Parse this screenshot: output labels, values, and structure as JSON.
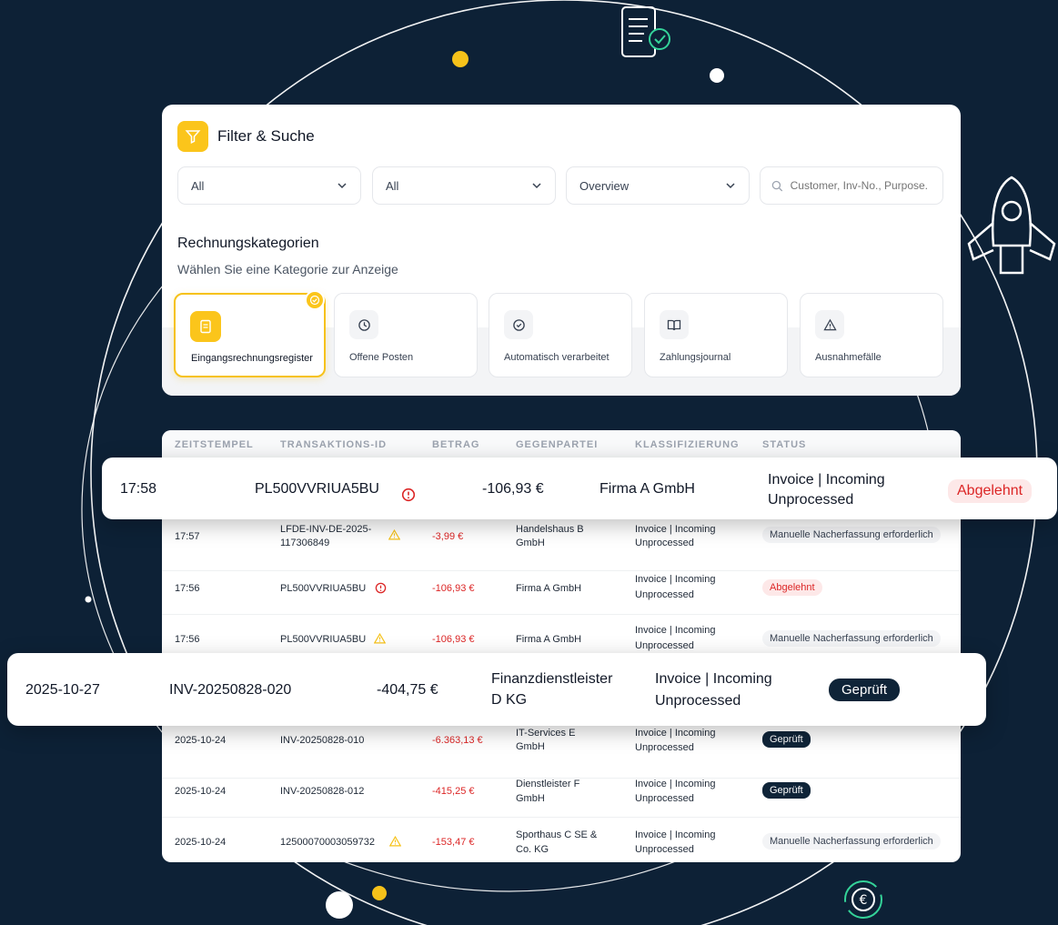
{
  "filter": {
    "title": "Filter & Suche",
    "select1": "All",
    "select2": "All",
    "select3": "Overview",
    "search_placeholder": "Customer, Inv-No., Purpose."
  },
  "categories": {
    "title": "Rechnungskategorien",
    "subtitle": "Wählen Sie eine Kategorie zur Anzeige",
    "items": [
      {
        "label": "Eingangsrechnungsregister",
        "icon": "document-icon",
        "active": true
      },
      {
        "label": "Offene Posten",
        "icon": "clock-icon"
      },
      {
        "label": "Automatisch verarbeitet",
        "icon": "check-circle-icon"
      },
      {
        "label": "Zahlungsjournal",
        "icon": "book-icon"
      },
      {
        "label": "Ausnahmefälle",
        "icon": "warning-icon"
      }
    ]
  },
  "table": {
    "headers": [
      "ZEITSTEMPEL",
      "TRANSAKTIONS-ID",
      "BETRAG",
      "GEGENPARTEI",
      "KLASSIFIZIERUNG",
      "STATUS"
    ],
    "rows": [
      {
        "time": "17:57",
        "id1": "LFDE-INV-DE-2025-",
        "id2": "117306849",
        "flag": "warning",
        "amount": "-3,99 €",
        "party1": "Handelshaus B",
        "party2": "GmbH",
        "class1": "Invoice | Incoming",
        "class2": "Unprocessed",
        "status": "Manuelle Nacherfassung erforderlich",
        "status_type": "gray"
      },
      {
        "time": "17:56",
        "id1": "PL500VVRIUA5BU",
        "id2": "",
        "flag": "error",
        "amount": "-106,93 €",
        "party1": "Firma A GmbH",
        "party2": "",
        "class1": "Invoice | Incoming",
        "class2": "Unprocessed",
        "status": "Abgelehnt",
        "status_type": "red"
      },
      {
        "time": "17:56",
        "id1": "PL500VVRIUA5BU",
        "id2": "",
        "flag": "warning",
        "amount": "-106,93 €",
        "party1": "Firma A GmbH",
        "party2": "",
        "class1": "Invoice | Incoming",
        "class2": "Unprocessed",
        "status": "Manuelle Nacherfassung erforderlich",
        "status_type": "gray"
      },
      {
        "time": "2025-10-24",
        "id1": "INV-20250828-010",
        "id2": "",
        "flag": "",
        "amount": "-6.363,13 €",
        "party1": "IT-Services E",
        "party2": "GmbH",
        "class1": "Invoice | Incoming",
        "class2": "Unprocessed",
        "status": "Geprüft",
        "status_type": "dark"
      },
      {
        "time": "2025-10-24",
        "id1": "INV-20250828-012",
        "id2": "",
        "flag": "",
        "amount": "-415,25 €",
        "party1": "Dienstleister F",
        "party2": "GmbH",
        "class1": "Invoice | Incoming",
        "class2": "Unprocessed",
        "status": "Geprüft",
        "status_type": "dark"
      },
      {
        "time": "2025-10-24",
        "id1": "12500070003059732",
        "id2": "",
        "flag": "warning",
        "amount": "-153,47 €",
        "party1": "Sporthaus C SE &",
        "party2": "Co. KG",
        "class1": "Invoice | Incoming",
        "class2": "Unprocessed",
        "status": "Manuelle Nacherfassung erforderlich",
        "status_type": "gray"
      }
    ]
  },
  "float1": {
    "time": "17:58",
    "id": "PL500VVRIUA5BU",
    "amount": "-106,93 €",
    "party": "Firma A GmbH",
    "class1": "Invoice | Incoming",
    "class2": "Unprocessed",
    "status": "Abgelehnt"
  },
  "float2": {
    "time": "2025-10-27",
    "id": "INV-20250828-020",
    "amount": "-404,75 €",
    "party1": "Finanzdienstleister",
    "party2": "D KG",
    "class1": "Invoice | Incoming",
    "class2": "Unprocessed",
    "status": "Geprüft"
  },
  "colors": {
    "accent": "#fbc51b",
    "background": "#0d2136",
    "negative": "#dc2626",
    "dark_badge": "#0f2438"
  }
}
